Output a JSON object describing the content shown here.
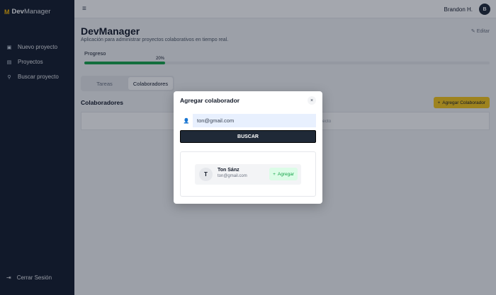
{
  "sidebar": {
    "brand_logo": "M",
    "brand_part1": "Dev",
    "brand_part2": "Manager",
    "items": [
      {
        "label": "Nuevo proyecto",
        "icon": "plus-square-icon",
        "glyph": "▣"
      },
      {
        "label": "Proyectos",
        "icon": "folder-icon",
        "glyph": "▤"
      },
      {
        "label": "Buscar proyecto",
        "icon": "search-icon",
        "glyph": "⚲"
      }
    ],
    "logout_label": "Cerrar Sesión",
    "logout_glyph": "⇥"
  },
  "topbar": {
    "menu_glyph": "≡",
    "user_name": "Brandon H.",
    "avatar_initial": "B"
  },
  "project": {
    "title": "DevManager",
    "subtitle": "Aplicación para administrar proyectos colaborativos en tiempo real.",
    "edit_label": "Editar",
    "edit_glyph": "✎"
  },
  "progress": {
    "label": "Progreso",
    "percent_text": "20%",
    "value": 0.2,
    "color": "#16a34a"
  },
  "tabs": [
    {
      "label": "Tareas",
      "active": false
    },
    {
      "label": "Colaboradores",
      "active": true
    }
  ],
  "collaborators": {
    "section_title": "Colaboradores",
    "add_button_label": "Agregar Colaborador",
    "add_glyph": "+",
    "empty_text_fragment": "ecto"
  },
  "modal": {
    "title": "Agregar colaborador",
    "close_glyph": "×",
    "search_icon_glyph": "👤",
    "search_value": "ton@gmail.com",
    "search_button_label": "BUSCAR",
    "result": {
      "initial": "T",
      "name": "Ton Sánz",
      "email": "ton@gmail.com",
      "add_label": "Agregar",
      "add_glyph": "+"
    }
  },
  "colors": {
    "sidebar_bg": "#131b2b",
    "accent_yellow": "#f5c518",
    "success_green": "#16a34a"
  }
}
